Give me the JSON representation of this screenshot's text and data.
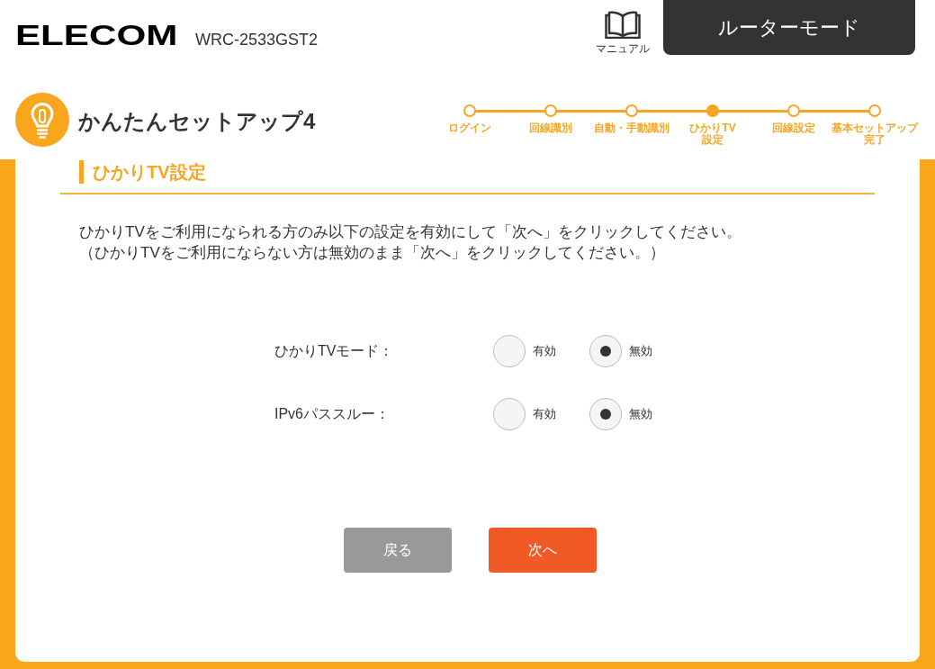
{
  "header": {
    "logo": "ELECOM",
    "model": "WRC-2533GST2",
    "manual_link": "マニュアル",
    "mode_button": "ルーターモード"
  },
  "setup": {
    "title": "かんたんセットアップ4",
    "steps": [
      {
        "lines": [
          "ログイン"
        ],
        "selected": false
      },
      {
        "lines": [
          "回線識別"
        ],
        "selected": false
      },
      {
        "lines": [
          "自動・手動識別"
        ],
        "selected": false
      },
      {
        "lines": [
          "ひかりTV",
          "設定"
        ],
        "selected": true
      },
      {
        "lines": [
          "回線設定"
        ],
        "selected": false
      },
      {
        "lines": [
          "基本セットアップ",
          "完了"
        ],
        "selected": false
      }
    ]
  },
  "section": {
    "title": "ひかりTV設定",
    "instructions": [
      "ひかりTVをご利用になられる方のみ以下の設定を有効にして「次へ」をクリックしてください。",
      "（ひかりTVをご利用にならない方は無効のまま「次へ」をクリックしてください。）"
    ],
    "settings": [
      {
        "label": "ひかりTVモード：",
        "options": [
          {
            "label": "有効",
            "selected": false
          },
          {
            "label": "無効",
            "selected": true
          }
        ]
      },
      {
        "label": "IPv6パススルー：",
        "options": [
          {
            "label": "有効",
            "selected": false
          },
          {
            "label": "無効",
            "selected": true
          }
        ]
      }
    ]
  },
  "buttons": [
    {
      "label": "戻る",
      "kind": "secondary"
    },
    {
      "label": "次へ",
      "kind": "primary"
    }
  ]
}
